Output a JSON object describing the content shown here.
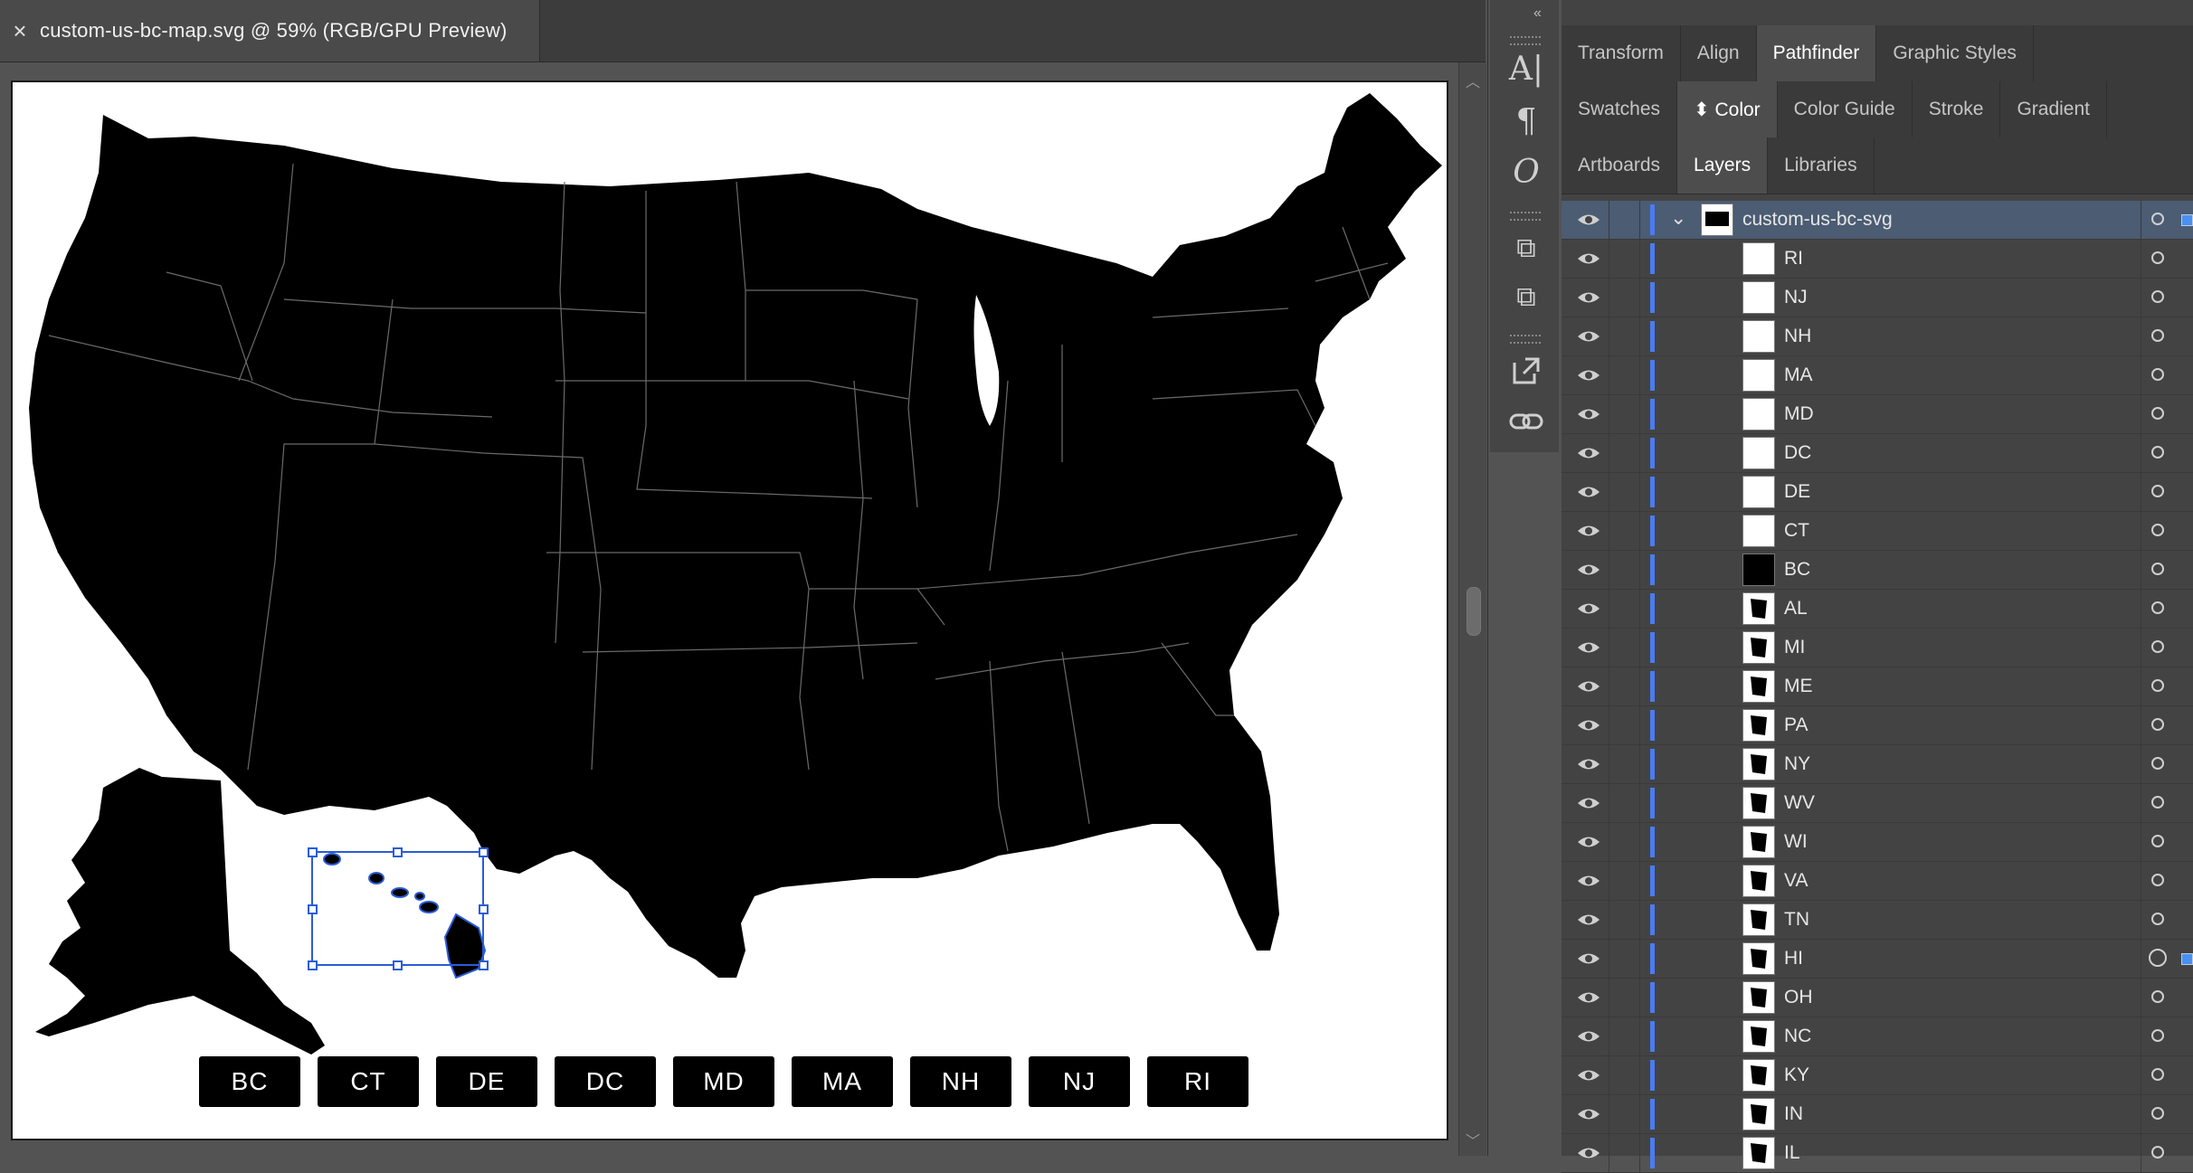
{
  "document": {
    "close_glyph": "×",
    "title": "custom-us-bc-map.svg @ 59% (RGB/GPU Preview)"
  },
  "map": {
    "fill_color": "#000000",
    "border_color": "#6a6a6a",
    "selection_color": "#2a5cd8",
    "selected_layer": "HI"
  },
  "buttons": [
    "BC",
    "CT",
    "DE",
    "DC",
    "MD",
    "MA",
    "NH",
    "NJ",
    "RI"
  ],
  "toolstrip": {
    "collapse_glyph": "«",
    "tools": [
      "character-icon",
      "paragraph-icon",
      "opentype-icon",
      "character-styles-icon",
      "paragraph-styles-icon",
      "export-icon",
      "links-icon"
    ]
  },
  "panel": {
    "tab_rows": [
      {
        "tabs": [
          "Transform",
          "Align",
          "Pathfinder",
          "Graphic Styles"
        ],
        "active": "Pathfinder"
      },
      {
        "tabs": [
          "Swatches",
          "Color",
          "Color Guide",
          "Stroke",
          "Gradient"
        ],
        "active": "Color"
      },
      {
        "tabs": [
          "Artboards",
          "Layers",
          "Libraries"
        ],
        "active": "Layers"
      }
    ],
    "accent_color": "#4a7cf0",
    "top_layer": "custom-us-bc-svg",
    "layers": [
      "RI",
      "NJ",
      "NH",
      "MA",
      "MD",
      "DC",
      "DE",
      "CT",
      "BC",
      "AL",
      "MI",
      "ME",
      "PA",
      "NY",
      "WV",
      "WI",
      "VA",
      "TN",
      "HI",
      "OH",
      "NC",
      "KY",
      "IN",
      "IL"
    ]
  }
}
